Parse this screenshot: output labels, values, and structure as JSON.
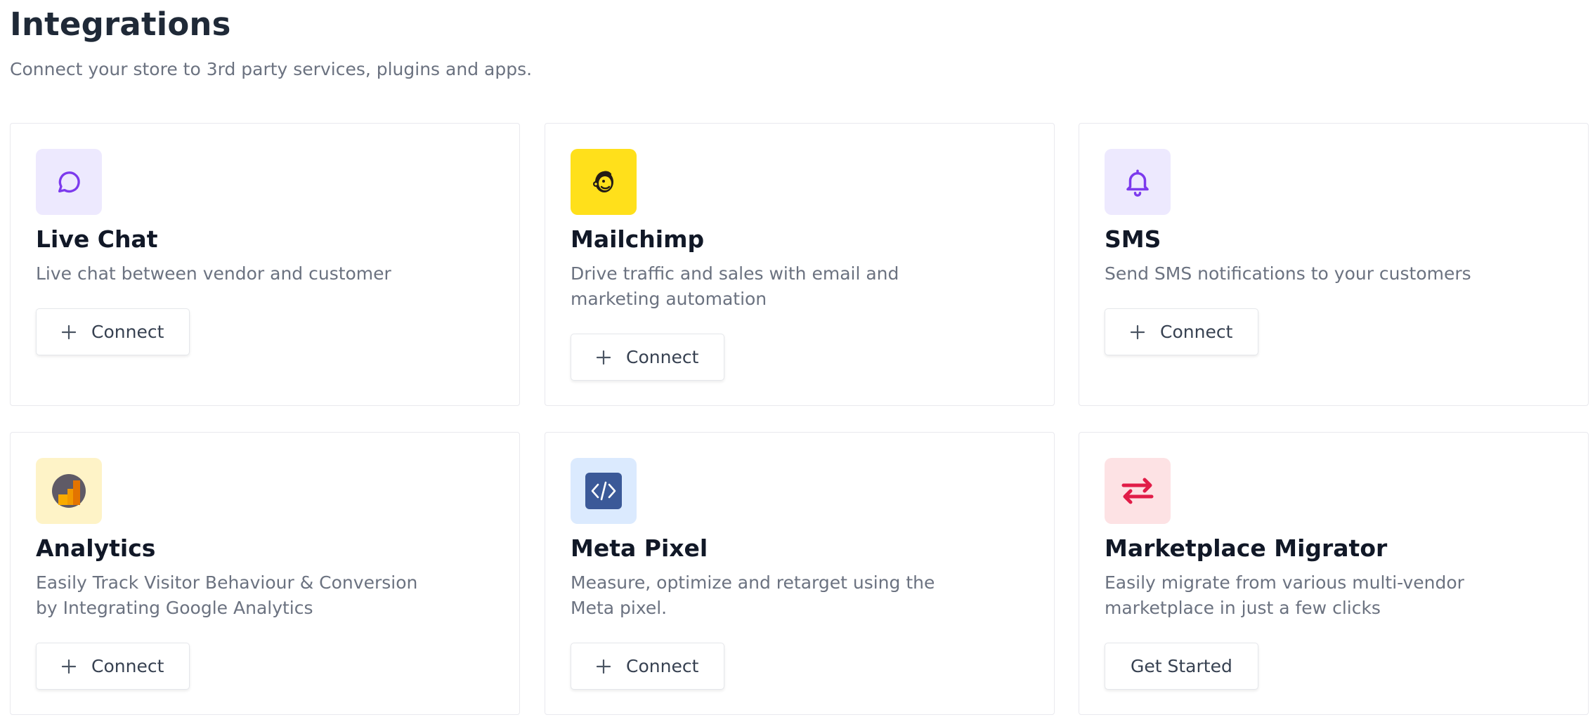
{
  "header": {
    "title": "Integrations",
    "subtitle": "Connect your store to 3rd party services, plugins and apps."
  },
  "cards": [
    {
      "title": "Live Chat",
      "description": "Live chat between vendor and customer",
      "button_label": "Connect",
      "icon": "chat-bubble-icon",
      "icon_bg": "#ede9fe",
      "icon_color": "#7c3aed"
    },
    {
      "title": "Mailchimp",
      "description": "Drive traffic and sales with email and marketing automation",
      "button_label": "Connect",
      "icon": "mailchimp-logo-icon",
      "icon_bg": "#ffe01b",
      "icon_color": "#241c15"
    },
    {
      "title": "SMS",
      "description": "Send SMS notifications to your customers",
      "button_label": "Connect",
      "icon": "bell-icon",
      "icon_bg": "#ede9fe",
      "icon_color": "#7c3aed"
    },
    {
      "title": "Analytics",
      "description": "Easily Track Visitor Behaviour & Conversion by Integrating Google Analytics",
      "button_label": "Connect",
      "icon": "google-analytics-icon",
      "icon_bg": "#fef3c7",
      "icon_color": "#f9ab00"
    },
    {
      "title": "Meta Pixel",
      "description": "Measure, optimize and retarget using the Meta pixel.",
      "button_label": "Connect",
      "icon": "code-icon",
      "icon_bg": "#dbeafe",
      "icon_color": "#3b5998"
    },
    {
      "title": "Marketplace Migrator",
      "description": "Easily migrate from various multi-vendor marketplace in just a few clicks",
      "button_label": "Get Started",
      "icon": "swap-arrows-icon",
      "icon_bg": "#fde2e4",
      "icon_color": "#e11d48"
    }
  ]
}
